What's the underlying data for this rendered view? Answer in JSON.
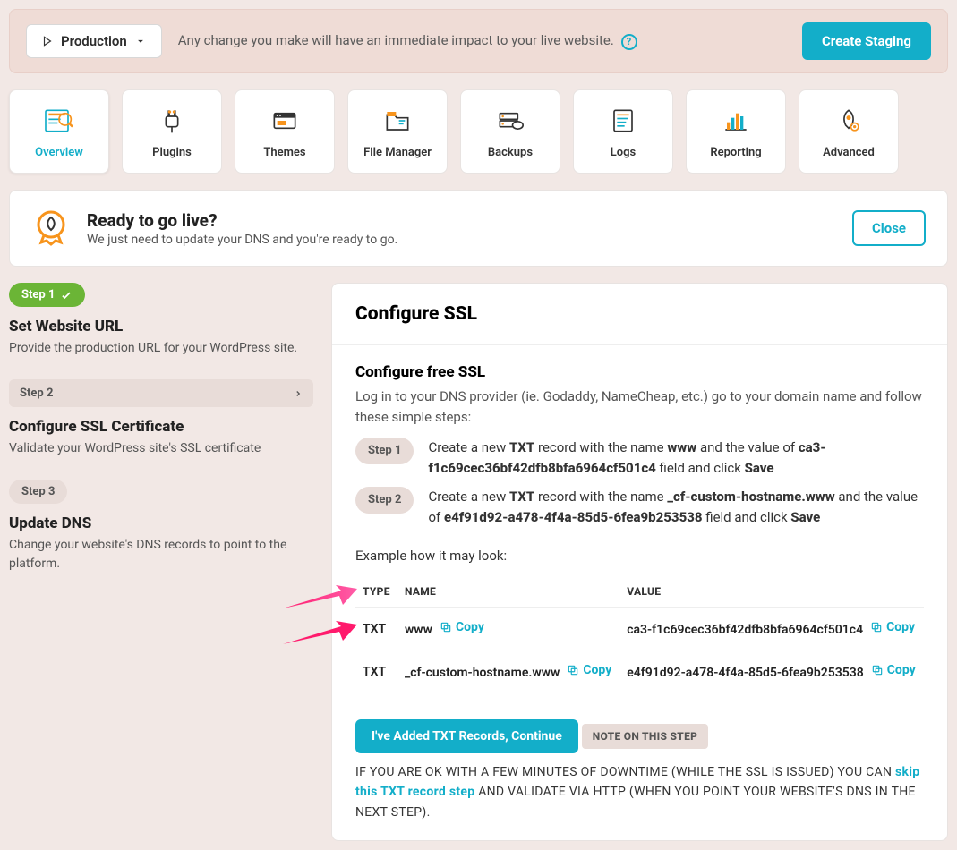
{
  "topbar": {
    "env": "Production",
    "message": "Any change you make will have an immediate impact to your live website.",
    "cta": "Create Staging"
  },
  "tabs": [
    "Overview",
    "Plugins",
    "Themes",
    "File Manager",
    "Backups",
    "Logs",
    "Reporting",
    "Advanced"
  ],
  "banner": {
    "title": "Ready to go live?",
    "sub": "We just need to update your DNS and you're ready to go.",
    "close": "Close"
  },
  "side": {
    "s1": {
      "pill": "Step 1",
      "title": "Set Website URL",
      "desc": "Provide the production URL for your WordPress site."
    },
    "s2": {
      "pill": "Step 2",
      "title": "Configure SSL Certificate",
      "desc": "Validate your WordPress site's SSL certificate"
    },
    "s3": {
      "pill": "Step 3",
      "title": "Update DNS",
      "desc": "Change your website's DNS records to point to the platform."
    }
  },
  "main": {
    "title": "Configure SSL",
    "subtitle": "Configure free SSL",
    "intro": "Log in to your DNS provider (ie. Godaddy, NameCheap, etc.) go to your domain name and follow these simple steps:",
    "step1_pre": "Create a new ",
    "step1_txt": "TXT",
    "step1_mid": " record with the name ",
    "step1_name": "www",
    "step1_mid2": " and the value of ",
    "step1_val": "ca3-f1c69cec36bf42dfb8bfa6964cf501c4",
    "step1_end": " field and click ",
    "step1_save": "Save",
    "step2_pre": "Create a new ",
    "step2_txt": "TXT",
    "step2_mid": " record with the name ",
    "step2_name": "_cf-custom-hostname.www",
    "step2_mid2": " and the value of ",
    "step2_val": "e4f91d92-a478-4f4a-85d5-6fea9b253538",
    "step2_end": " field and click ",
    "step2_save": "Save",
    "step1_badge": "Step 1",
    "step2_badge": "Step 2",
    "example": "Example how it may look:",
    "th": {
      "type": "TYPE",
      "name": "NAME",
      "value": "VALUE"
    },
    "rows": [
      {
        "type": "TXT",
        "name": "www",
        "value": "ca3-f1c69cec36bf42dfb8bfa6964cf501c4"
      },
      {
        "type": "TXT",
        "name": "_cf-custom-hostname.www",
        "value": "e4f91d92-a478-4f4a-85d5-6fea9b253538"
      }
    ],
    "copy": "Copy",
    "continue": "I've Added TXT Records, Continue",
    "note_badge": "NOTE ON THIS STEP",
    "note_pre": "IF YOU ARE OK WITH A FEW MINUTES OF DOWNTIME (WHILE THE SSL IS ISSUED) YOU CAN ",
    "note_link": "skip this TXT record step",
    "note_post": " AND VALIDATE VIA HTTP (WHEN YOU POINT YOUR WEBSITE'S DNS IN THE NEXT STEP)."
  }
}
